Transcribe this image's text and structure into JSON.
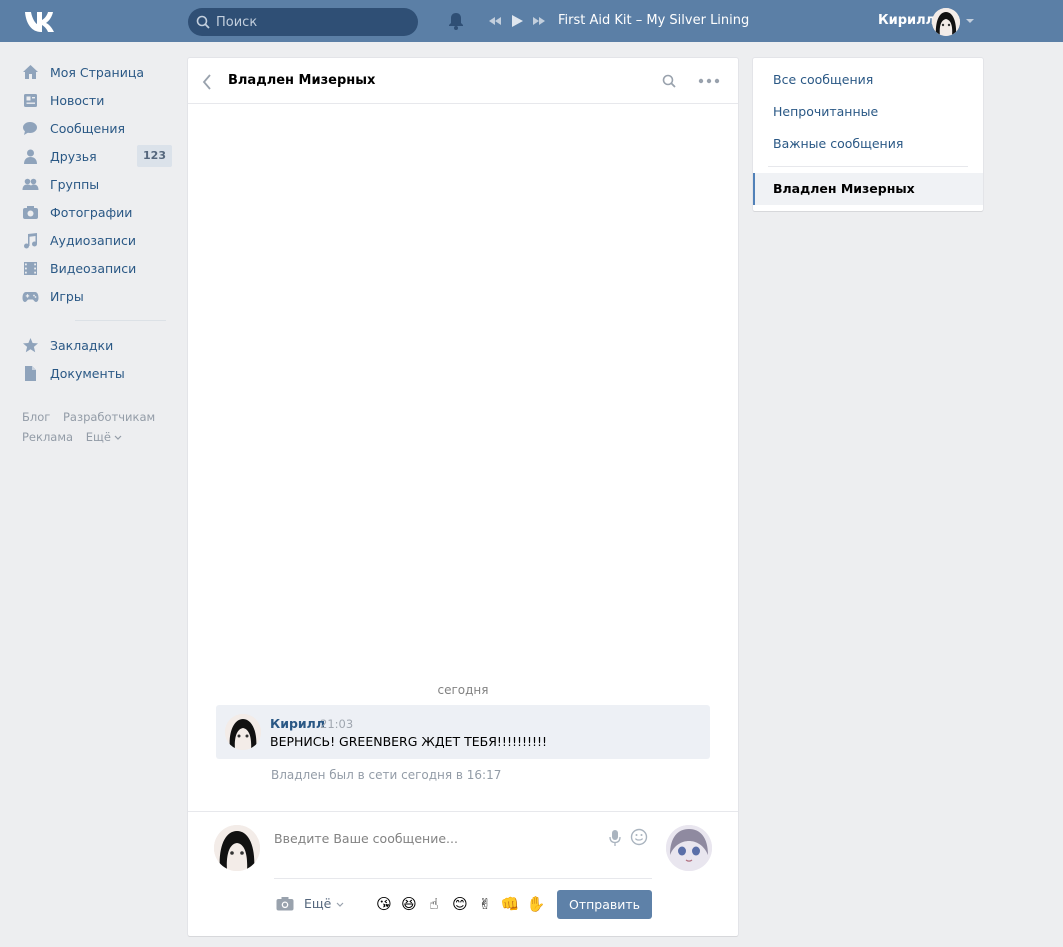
{
  "header": {
    "search_placeholder": "Поиск",
    "track": "First Aid Kit – My Silver Lining",
    "user_name": "Кирилл"
  },
  "sidebar": {
    "items": [
      {
        "label": "Моя Страница",
        "icon": "home-icon"
      },
      {
        "label": "Новости",
        "icon": "news-icon"
      },
      {
        "label": "Сообщения",
        "icon": "messages-icon"
      },
      {
        "label": "Друзья",
        "icon": "friends-icon",
        "badge": "123"
      },
      {
        "label": "Группы",
        "icon": "groups-icon"
      },
      {
        "label": "Фотографии",
        "icon": "photos-icon"
      },
      {
        "label": "Аудиозаписи",
        "icon": "music-icon"
      },
      {
        "label": "Видеозаписи",
        "icon": "video-icon"
      },
      {
        "label": "Игры",
        "icon": "games-icon"
      }
    ],
    "secondary": [
      {
        "label": "Закладки",
        "icon": "star-icon"
      },
      {
        "label": "Документы",
        "icon": "document-icon"
      }
    ],
    "footer": [
      "Блог",
      "Разработчикам",
      "Реклама",
      "Ещё"
    ]
  },
  "chat": {
    "title": "Владлен Мизерных",
    "day_separator": "сегодня",
    "message": {
      "author": "Кирилл",
      "time": "21:03",
      "text": "ВЕРНИСЬ! GREENBERG ЖДЕТ ТЕБЯ!!!!!!!!!!"
    },
    "online_note": "Владлен был в сети сегодня в 16:17",
    "composer": {
      "placeholder": "Введите Ваше сообщение...",
      "more_label": "Ещё",
      "send_label": "Отправить",
      "emojis": [
        "😘",
        "😆",
        "☝",
        "😊",
        "✌",
        "👊",
        "✋"
      ]
    }
  },
  "right_menu": {
    "items": [
      "Все сообщения",
      "Непрочитанные",
      "Важные сообщения"
    ],
    "active": "Владлен Мизерных"
  },
  "colors": {
    "header_bg": "#5b7fa6",
    "link": "#2a5885",
    "send_button": "#5e81a8"
  }
}
